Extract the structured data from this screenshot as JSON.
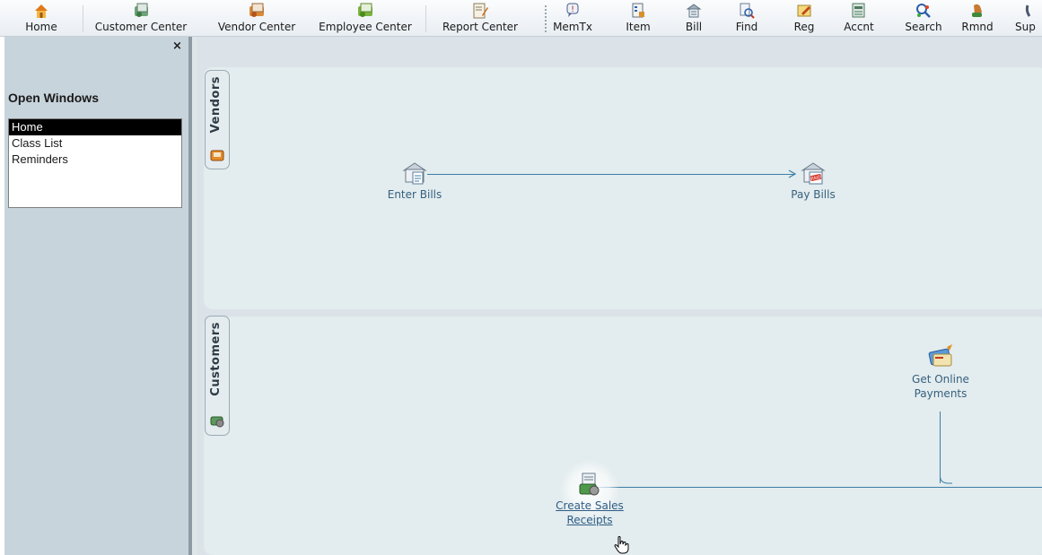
{
  "toolbar": {
    "items": [
      {
        "label": "Home",
        "icon": "home-icon"
      },
      {
        "label": "Customer Center",
        "icon": "customer-center-icon"
      },
      {
        "label": "Vendor Center",
        "icon": "vendor-center-icon"
      },
      {
        "label": "Employee Center",
        "icon": "employee-center-icon"
      },
      {
        "label": "Report Center",
        "icon": "report-center-icon"
      },
      {
        "label": "MemTx",
        "icon": "memtx-icon"
      },
      {
        "label": "Item",
        "icon": "item-icon"
      },
      {
        "label": "Bill",
        "icon": "bill-icon"
      },
      {
        "label": "Find",
        "icon": "find-icon"
      },
      {
        "label": "Reg",
        "icon": "register-icon"
      },
      {
        "label": "Accnt",
        "icon": "account-icon"
      },
      {
        "label": "Search",
        "icon": "search-icon"
      },
      {
        "label": "Rmnd",
        "icon": "reminder-icon"
      },
      {
        "label": "Sup",
        "icon": "support-icon"
      }
    ]
  },
  "left_panel": {
    "close_glyph": "×",
    "title": "Open Windows",
    "items": [
      "Home",
      "Class List",
      "Reminders"
    ],
    "selected": "Home"
  },
  "vendors": {
    "tab_label": "Vendors",
    "enter_bills": "Enter Bills",
    "pay_bills": "Pay Bills",
    "paid_stamp": "PAID"
  },
  "customers": {
    "tab_label": "Customers",
    "get_online_payments_line1": "Get Online",
    "get_online_payments_line2": "Payments",
    "create_sales_receipts_line1": "Create Sales",
    "create_sales_receipts_line2": "Receipts"
  },
  "colors": {
    "accent_line": "#3d7ea6",
    "panel_bg": "#c8d4dc",
    "section_bg": "#e3ecee"
  }
}
